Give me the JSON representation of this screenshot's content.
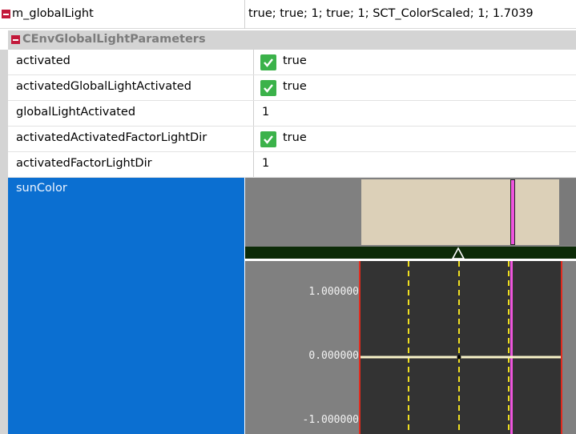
{
  "top_row": {
    "name": "m_globalLight",
    "value": "true; true; 1; true; 1; SCT_ColorScaled; 1; 1.7039"
  },
  "group": {
    "label": "CEnvGlobalLightParameters"
  },
  "properties": [
    {
      "name": "activated",
      "value": "true",
      "checked": true
    },
    {
      "name": "activatedGlobalLightActivated",
      "value": "true",
      "checked": true
    },
    {
      "name": "globalLightActivated",
      "value": "1",
      "checked": false
    },
    {
      "name": "activatedActivatedFactorLightDir",
      "value": "true",
      "checked": true
    },
    {
      "name": "activatedFactorLightDir",
      "value": "1",
      "checked": false
    }
  ],
  "sun_color": {
    "label": "sunColor",
    "y_axis_labels": [
      "1.000000",
      "0.000000",
      "-1.000000"
    ],
    "curve_value": 0.0,
    "y_range": [
      -1.2,
      1.5
    ]
  },
  "colors": {
    "selection_blue": "#0b6fd1",
    "checkbox_green": "#3bb24a",
    "curve_yellow": "#f0e020",
    "marker_magenta": "#ee55dd",
    "range_red": "#e32b1e"
  }
}
